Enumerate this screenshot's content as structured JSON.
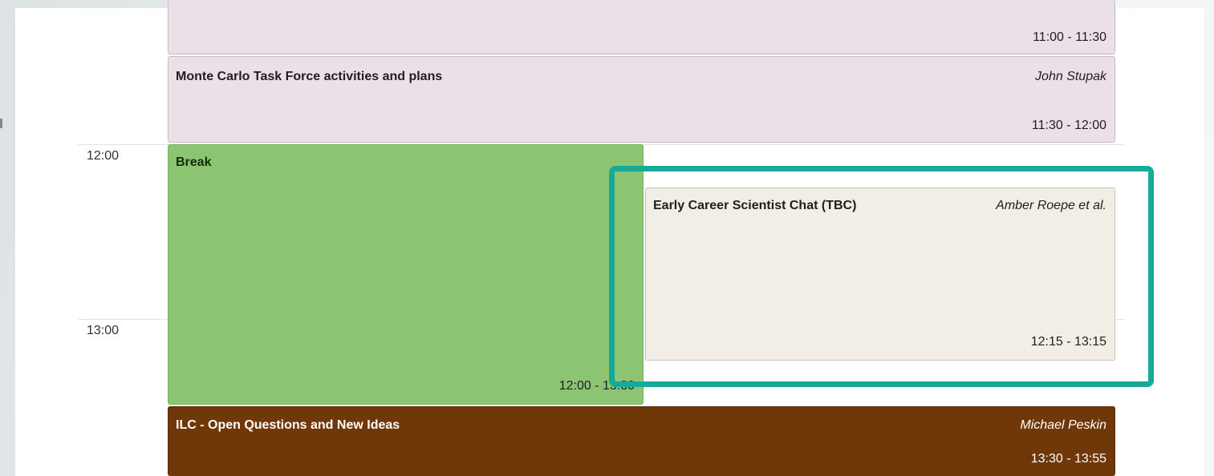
{
  "colors": {
    "session_pink": "#ebdfe8",
    "break_green": "#8cc572",
    "contribution_cream": "#f3eee5",
    "session_brown": "#703808",
    "highlight_teal": "#17a99a"
  },
  "timeline": {
    "hour_labels": [
      "12:00",
      "13:00"
    ]
  },
  "entries": [
    {
      "title": "",
      "speaker": "",
      "time": "11:00 - 11:30"
    },
    {
      "title": "Monte Carlo Task Force activities and plans",
      "speaker": "John Stupak",
      "time": "11:30 - 12:00"
    },
    {
      "title": "Break",
      "speaker": "",
      "time": "12:00 - 13:30"
    },
    {
      "title": "Early Career Scientist Chat (TBC)",
      "speaker": "Amber Roepe et al.",
      "time": "12:15 - 13:15"
    },
    {
      "title": "ILC - Open Questions and New Ideas",
      "speaker": "Michael Peskin",
      "time": "13:30 - 13:55"
    }
  ]
}
